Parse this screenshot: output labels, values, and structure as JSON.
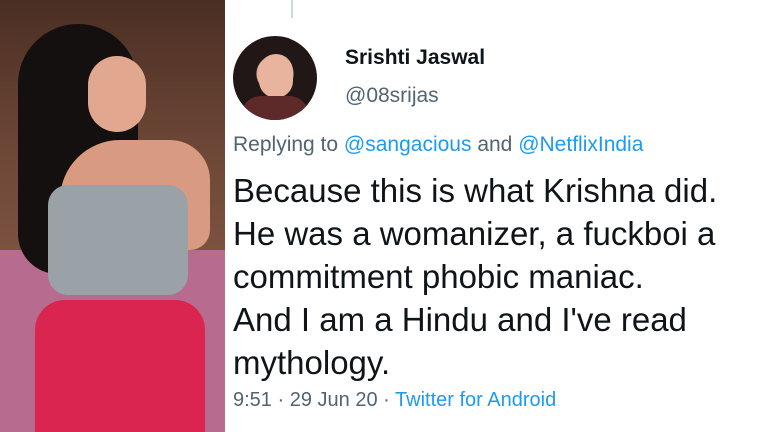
{
  "tweet": {
    "display_name": "Srishti Jaswal",
    "handle": "@08srijas",
    "replying_prefix": "Replying to",
    "reply_mentions": [
      "@sangacious",
      "@NetflixIndia"
    ],
    "replying_connector": "and",
    "body_lines": [
      "Because this is what Krishna did.",
      "He was a womanizer, a fuckboi a",
      "commitment phobic maniac.",
      "And I am a Hindu and I've read",
      "mythology."
    ],
    "time": "9:51",
    "separator": "·",
    "date": "29 Jun 20",
    "source": "Twitter for Android"
  },
  "colors": {
    "text_primary": "#0f1419",
    "text_secondary": "#536471",
    "link_blue": "#1d9bf0"
  },
  "icons": {
    "avatar": "profile-photo",
    "left_photo": "person-photo"
  }
}
